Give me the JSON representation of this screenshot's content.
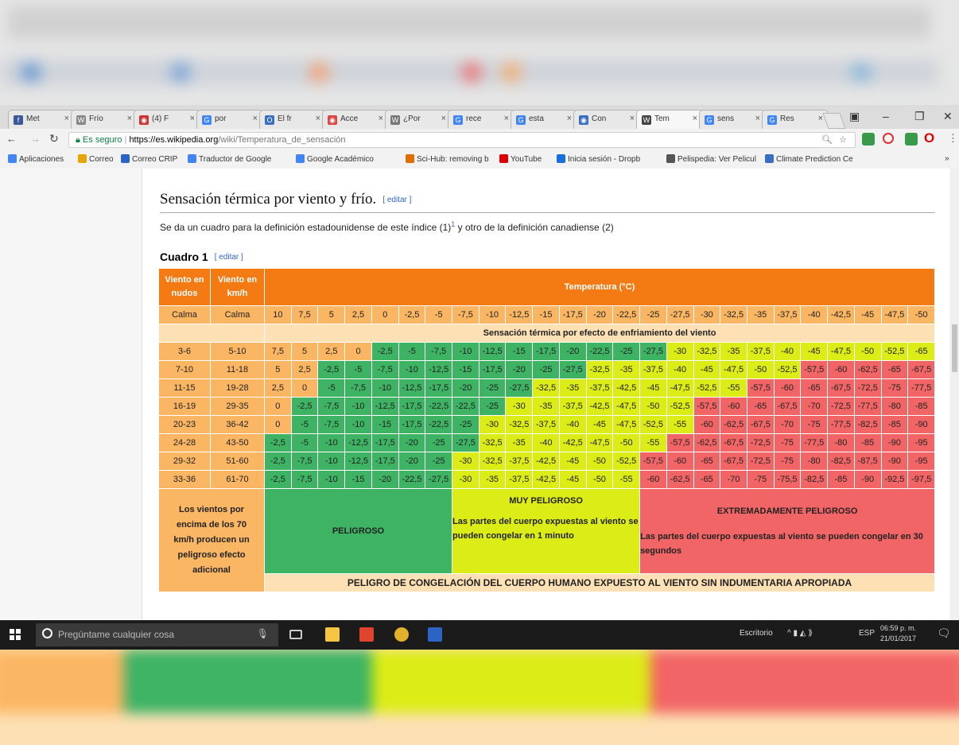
{
  "colors": {
    "header_orange": "#f47b14",
    "label_orange": "#fbb663",
    "band": "#fde0b4",
    "green": "#3eb364",
    "yellow": "#dcec16",
    "red": "#f26566"
  },
  "browser": {
    "tabs": [
      "Met",
      "Frío",
      "(4) F",
      "por",
      "El fr",
      "Acce",
      "¿Por",
      "rece",
      "esta",
      "Con",
      "Tem",
      "sens",
      "Res"
    ],
    "active_tab": 10,
    "secure_label": "Es seguro",
    "url_host": "https://es.wikipedia.org",
    "url_path": "/wiki/Temperatura_de_sensación",
    "bookmarks": [
      "Aplicaciones",
      "Correo",
      "Correo CRIP",
      "Traductor de Google",
      "Google Académico",
      "Sci-Hub: removing b",
      "YouTube",
      "Inicia sesión - Dropb",
      "Pelispedia: Ver Pelicul",
      "Climate Prediction Ce"
    ]
  },
  "article": {
    "heading": "Sensación térmica por viento y frío.",
    "edit_label": "[ editar ]",
    "paragraph_a": "Se da un cuadro para la definición estadounidense de este índice (1)",
    "footnote": "1",
    "paragraph_b": " y otro de la definición canadiense (2)",
    "subheading": "Cuadro 1",
    "sub_edit_label": "[ editar ]"
  },
  "table": {
    "col1_header": "Viento en nudos",
    "col2_header": "Viento en km/h",
    "temp_header": "Temperatura (°C)",
    "calm_label": "Calma",
    "temps": [
      "10",
      "7,5",
      "5",
      "2,5",
      "0",
      "-2,5",
      "-5",
      "-7,5",
      "-10",
      "-12,5",
      "-15",
      "-17,5",
      "-20",
      "-22,5",
      "-25",
      "-27,5",
      "-30",
      "-32,5",
      "-35",
      "-37,5",
      "-40",
      "-42,5",
      "-45",
      "-47,5",
      "-50"
    ],
    "band_label": "Sensación térmica por efecto de enfriamiento del viento",
    "rows": [
      {
        "knots": "3-6",
        "kmh": "5-10",
        "values": [
          "7,5",
          "5",
          "2,5",
          "0",
          "-2,5",
          "-5",
          "-7,5",
          "-10",
          "-12,5",
          "-15",
          "-17,5",
          "-20",
          "-22,5",
          "-25",
          "-27,5",
          "-30",
          "-32,5",
          "-35",
          "-37,5",
          "-40",
          "-45",
          "-47,5",
          "-50",
          "-52,5",
          "-65"
        ],
        "colors": "....gggggggggggyyyyyyyyyy"
      },
      {
        "knots": "7-10",
        "kmh": "11-18",
        "values": [
          "5",
          "2,5",
          "-2,5",
          "-5",
          "-7,5",
          "-10",
          "-12,5",
          "-15",
          "-17,5",
          "-20",
          "-25",
          "-27,5",
          "-32,5",
          "-35",
          "-37,5",
          "-40",
          "-45",
          "-47,5",
          "-50",
          "-52,5",
          "-57,5",
          "-60",
          "-62,5",
          "-65",
          "-67,5"
        ],
        "colors": "..ggggggggggyyyyyyyyrrrrr"
      },
      {
        "knots": "11-15",
        "kmh": "19-28",
        "values": [
          "2,5",
          "0",
          "-5",
          "-7,5",
          "-10",
          "-12,5",
          "-17,5",
          "-20",
          "-25",
          "-27,5",
          "-32,5",
          "-35",
          "-37,5",
          "-42,5",
          "-45",
          "-47,5",
          "-52,5",
          "-55",
          "-57,5",
          "-60",
          "-65",
          "-67,5",
          "-72,5",
          "-75",
          "-77,5"
        ],
        "colors": "..ggggggggyyyyyyyyrrrrrrr"
      },
      {
        "knots": "16-19",
        "kmh": "29-35",
        "values": [
          "0",
          "-2,5",
          "-7,5",
          "-10",
          "-12,5",
          "-17,5",
          "-22,5",
          "-22,5",
          "-25",
          "-30",
          "-35",
          "-37,5",
          "-42,5",
          "-47,5",
          "-50",
          "-52,5",
          "-57,5",
          "-60",
          "-65",
          "-67,5",
          "-70",
          "-72,5",
          "-77,5",
          "-80",
          "-85"
        ],
        "colors": ".ggggggggyyyyyyyrrrrrrrrr"
      },
      {
        "knots": "20-23",
        "kmh": "36-42",
        "values": [
          "0",
          "-5",
          "-7,5",
          "-10",
          "-15",
          "-17,5",
          "-22,5",
          "-25",
          "-30",
          "-32,5",
          "-37,5",
          "-40",
          "-45",
          "-47,5",
          "-52,5",
          "-55",
          "-60",
          "-62,5",
          "-67,5",
          "-70",
          "-75",
          "-77,5",
          "-82,5",
          "-85",
          "-90"
        ],
        "colors": ".gggggggyyyyyyyyrrrrrrrrr"
      },
      {
        "knots": "24-28",
        "kmh": "43-50",
        "values": [
          "-2,5",
          "-5",
          "-10",
          "-12,5",
          "-17,5",
          "-20",
          "-25",
          "-27,5",
          "-32,5",
          "-35",
          "-40",
          "-42,5",
          "-47,5",
          "-50",
          "-55",
          "-57,5",
          "-62,5",
          "-67,5",
          "-72,5",
          "-75",
          "-77,5",
          "-80",
          "-85",
          "-90",
          "-95"
        ],
        "colors": "ggggggggyyyyyyyrrrrrrrrrr"
      },
      {
        "knots": "29-32",
        "kmh": "51-60",
        "values": [
          "-2,5",
          "-7,5",
          "-10",
          "-12,5",
          "-17,5",
          "-20",
          "-25",
          "-30",
          "-32,5",
          "-37,5",
          "-42,5",
          "-45",
          "-50",
          "-52,5",
          "-57,5",
          "-60",
          "-65",
          "-67,5",
          "-72,5",
          "-75",
          "-80",
          "-82,5",
          "-87,5",
          "-90",
          "-95"
        ],
        "colors": "gggggggyyyyyyyrrrrrrrrrrr"
      },
      {
        "knots": "33-36",
        "kmh": "61-70",
        "values": [
          "-2,5",
          "-7,5",
          "-10",
          "-15",
          "-20",
          "-22,5",
          "-27,5",
          "-30",
          "-35",
          "-37,5",
          "-42,5",
          "-45",
          "-50",
          "-55",
          "-60",
          "-62,5",
          "-65",
          "-70",
          "-75",
          "-75,5",
          "-82,5",
          "-85",
          "-90",
          "-92,5",
          "-97,5"
        ],
        "colors": "gggggggyyyyyyyrrrrrrrrrrr"
      }
    ],
    "legend_left": "Los vientos por encima de los 70 km/h producen un peligroso efecto adicional",
    "legend_green": "PELIGROSO",
    "legend_yellow_title": "MUY PELIGROSO",
    "legend_yellow_text": "Las partes del cuerpo expuestas al viento se pueden congelar en 1 minuto",
    "legend_red_title": "EXTREMADAMENTE PELIGROSO",
    "legend_red_text": "Las partes del cuerpo expuestas al viento se pueden congelar en 30 segundos",
    "footer_band": "PELIGRO DE CONGELACIÓN DEL CUERPO HUMANO EXPUESTO AL VIENTO SIN INDUMENTARIA APROPIADA"
  },
  "taskbar": {
    "search_placeholder": "Pregúntame cualquier cosa",
    "desktop_label": "Escritorio",
    "lang": "ESP",
    "time": "06:59 p. m.",
    "date": "21/01/2017"
  }
}
